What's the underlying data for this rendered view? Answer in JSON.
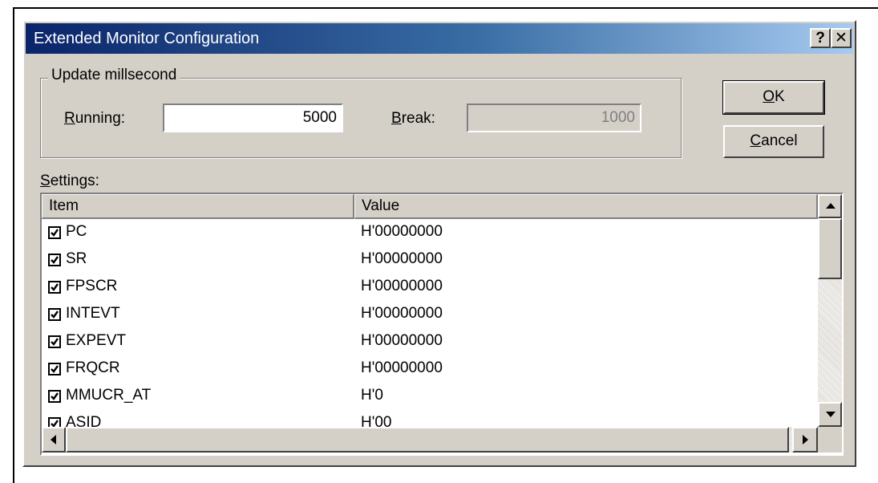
{
  "dialog": {
    "title": "Extended Monitor Configuration",
    "help_glyph": "?",
    "close_glyph": "✕"
  },
  "group": {
    "legend": "Update millsecond",
    "running_mnemonic": "R",
    "running_rest": "unning:",
    "running_value": "5000",
    "break_mnemonic": "B",
    "break_rest": "reak:",
    "break_value": "1000"
  },
  "buttons": {
    "ok_mnemonic": "O",
    "ok_rest": "K",
    "cancel_mnemonic": "C",
    "cancel_rest": "ancel"
  },
  "settings": {
    "label_mnemonic": "S",
    "label_rest": "ettings:",
    "columns": [
      "Item",
      "Value"
    ],
    "rows": [
      {
        "checked": true,
        "item": "PC",
        "value": "H'00000000"
      },
      {
        "checked": true,
        "item": "SR",
        "value": "H'00000000"
      },
      {
        "checked": true,
        "item": "FPSCR",
        "value": "H'00000000"
      },
      {
        "checked": true,
        "item": "INTEVT",
        "value": "H'00000000"
      },
      {
        "checked": true,
        "item": "EXPEVT",
        "value": "H'00000000"
      },
      {
        "checked": true,
        "item": "FRQCR",
        "value": "H'00000000"
      },
      {
        "checked": true,
        "item": "MMUCR_AT",
        "value": "H'0"
      },
      {
        "checked": true,
        "item": "ASID",
        "value": "H'00"
      }
    ]
  },
  "colors": {
    "face": "#d4d0c8",
    "title_start": "#0a246a",
    "title_end": "#a6caf0"
  }
}
